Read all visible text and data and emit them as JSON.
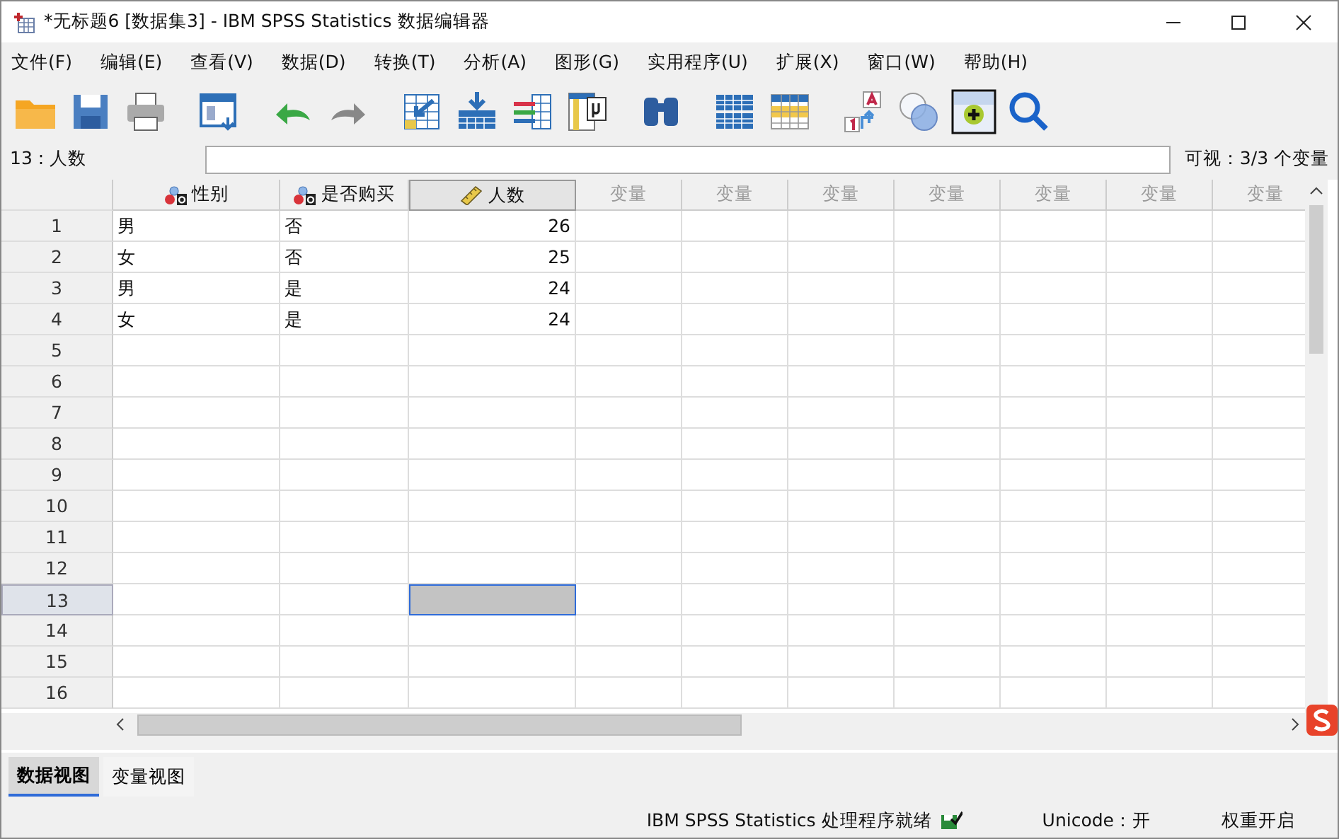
{
  "window": {
    "title": "*无标题6 [数据集3] - IBM SPSS Statistics 数据编辑器"
  },
  "menu": [
    "文件(F)",
    "编辑(E)",
    "查看(V)",
    "数据(D)",
    "转换(T)",
    "分析(A)",
    "图形(G)",
    "实用程序(U)",
    "扩展(X)",
    "窗口(W)",
    "帮助(H)"
  ],
  "cell_editor": {
    "reference": "13 : 人数",
    "visible": "可视：3/3 个变量"
  },
  "table": {
    "columns": [
      {
        "name": "性别",
        "kind": "nominal",
        "selected": false
      },
      {
        "name": "是否购买",
        "kind": "nominal",
        "selected": false
      },
      {
        "name": "人数",
        "kind": "scale",
        "selected": true
      },
      {
        "name": "变量",
        "kind": "empty",
        "selected": false
      },
      {
        "name": "变量",
        "kind": "empty",
        "selected": false
      },
      {
        "name": "变量",
        "kind": "empty",
        "selected": false
      },
      {
        "name": "变量",
        "kind": "empty",
        "selected": false
      },
      {
        "name": "变量",
        "kind": "empty",
        "selected": false
      },
      {
        "name": "变量",
        "kind": "empty",
        "selected": false
      },
      {
        "name": "变量",
        "kind": "empty",
        "selected": false
      }
    ],
    "rows": [
      {
        "number": "1",
        "cells": [
          "男",
          "否",
          "26"
        ],
        "selected": false
      },
      {
        "number": "2",
        "cells": [
          "女",
          "否",
          "25"
        ],
        "selected": false
      },
      {
        "number": "3",
        "cells": [
          "男",
          "是",
          "24"
        ],
        "selected": false
      },
      {
        "number": "4",
        "cells": [
          "女",
          "是",
          "24"
        ],
        "selected": false
      },
      {
        "number": "5",
        "selected": false
      },
      {
        "number": "6",
        "selected": false
      },
      {
        "number": "7",
        "selected": false
      },
      {
        "number": "8",
        "selected": false
      },
      {
        "number": "9",
        "selected": false
      },
      {
        "number": "10",
        "selected": false
      },
      {
        "number": "11",
        "selected": false
      },
      {
        "number": "12",
        "selected": false
      },
      {
        "number": "13",
        "selected": true
      },
      {
        "number": "14",
        "selected": false
      },
      {
        "number": "15",
        "selected": false
      },
      {
        "number": "16",
        "selected": false
      }
    ]
  },
  "view_tabs": [
    {
      "label": "数据视图",
      "selected": true
    },
    {
      "label": "变量视图",
      "selected": false
    }
  ],
  "status_bar": {
    "processor": "IBM SPSS Statistics 处理程序就绪",
    "unicode": "Unicode：开",
    "weight": "权重开启"
  }
}
